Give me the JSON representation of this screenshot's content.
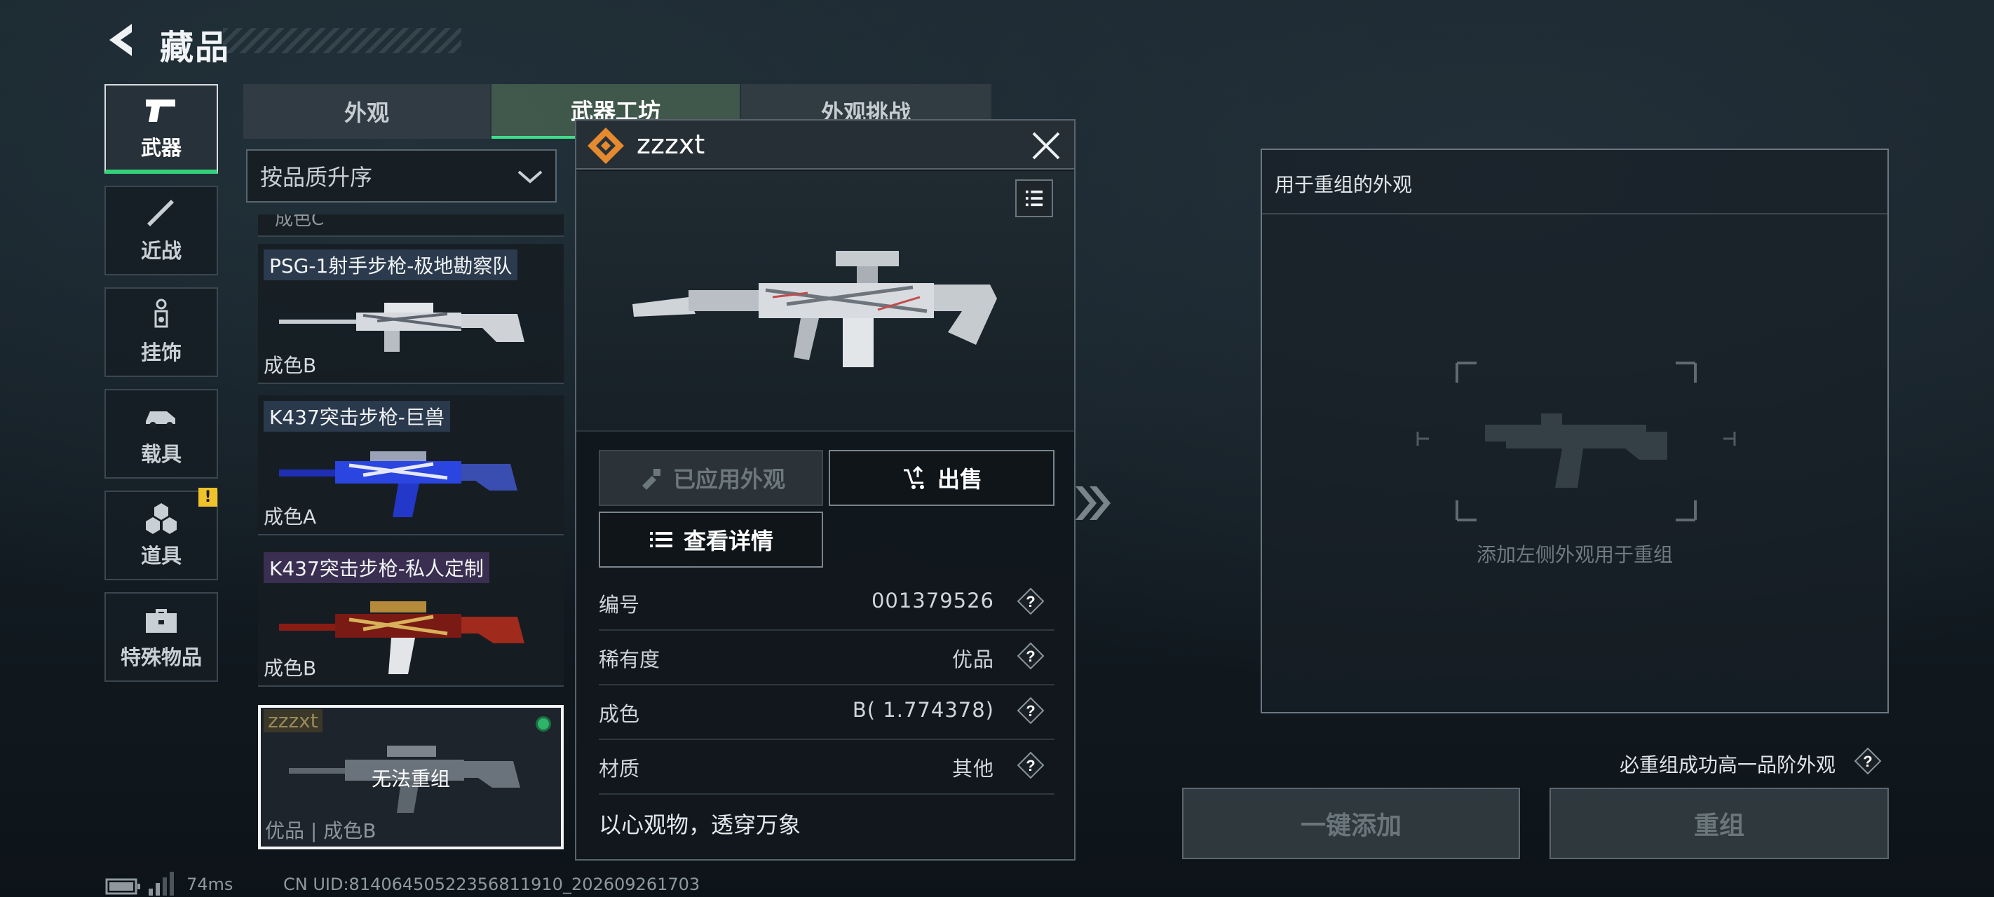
{
  "header": {
    "title": "藏品"
  },
  "sidebar": {
    "items": [
      {
        "label": "武器",
        "icon": "pistol-icon",
        "active": true
      },
      {
        "label": "近战",
        "icon": "knife-icon"
      },
      {
        "label": "挂饰",
        "icon": "charm-icon"
      },
      {
        "label": "载具",
        "icon": "vehicle-icon"
      },
      {
        "label": "道具",
        "icon": "items-icon",
        "badge": "!"
      },
      {
        "label": "特殊物品",
        "icon": "toolbox-icon"
      }
    ]
  },
  "tabs": [
    {
      "label": "外观"
    },
    {
      "label": "武器工坊",
      "active": true
    },
    {
      "label": "外观挑战"
    }
  ],
  "sort": {
    "value": "按品质升序"
  },
  "list": {
    "partial_condition": "成色C",
    "cards": [
      {
        "name": "PSG-1射手步枪-极地勘察队",
        "condition": "成色B"
      },
      {
        "name": "K437突击步枪-巨兽",
        "condition": "成色A"
      },
      {
        "name": "K437突击步枪-私人定制",
        "condition": "成色B"
      }
    ],
    "selected": {
      "tag": "zzzxt",
      "overlay": "无法重组",
      "meta": "优品 | 成色B"
    }
  },
  "popup": {
    "name": "zzzxt",
    "btn_applied": "已应用外观",
    "btn_sell": "出售",
    "btn_details": "查看详情",
    "rows": [
      {
        "key": "编号",
        "value": "001379526"
      },
      {
        "key": "稀有度",
        "value": "优品"
      },
      {
        "key": "成色",
        "value": "B( 1.774378)"
      },
      {
        "key": "材质",
        "value": "其他"
      }
    ],
    "motto": "以心观物，透穿万象"
  },
  "recombine_panel": {
    "title": "用于重组的外观",
    "hint": "添加左侧外观用于重组",
    "guarantee": "必重组成功高一品阶外观"
  },
  "actions": {
    "auto_add": "一键添加",
    "recombine": "重组"
  },
  "footer": {
    "ping": "74ms",
    "uid": "CN UID:8140645052235681191‌0_202609261703"
  },
  "colors": {
    "accent_green": "#33d17a",
    "badge_yellow": "#f0c22a",
    "logo_orange": "#e58a2e"
  }
}
